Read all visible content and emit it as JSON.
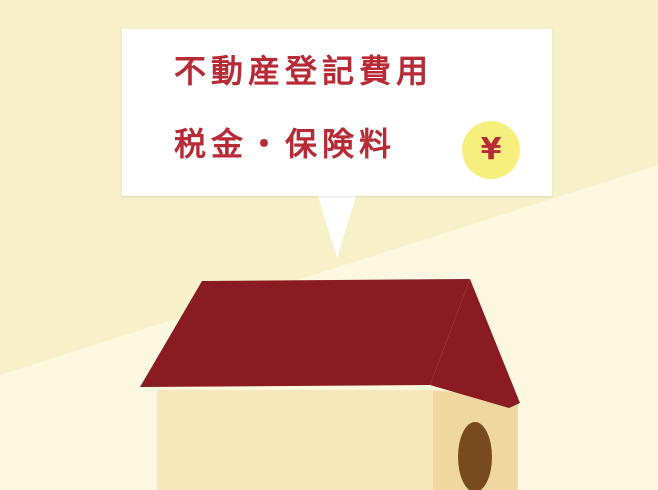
{
  "bubble": {
    "line1": "不動産登記費用",
    "line2": "税金・保険料",
    "currency_symbol": "¥"
  },
  "colors": {
    "background_light": "#fcf8df",
    "background_dark": "#f8f0c8",
    "bubble_background": "#ffffff",
    "text_red": "#b72b37",
    "yen_circle": "#f7ef7d",
    "roof": "#8a1b23",
    "house_front": "#f8e7b8",
    "house_side": "#efd8a0",
    "door": "#7a4a1f"
  },
  "icons": {
    "currency": "yen-circle-icon",
    "house": "house-icon"
  }
}
